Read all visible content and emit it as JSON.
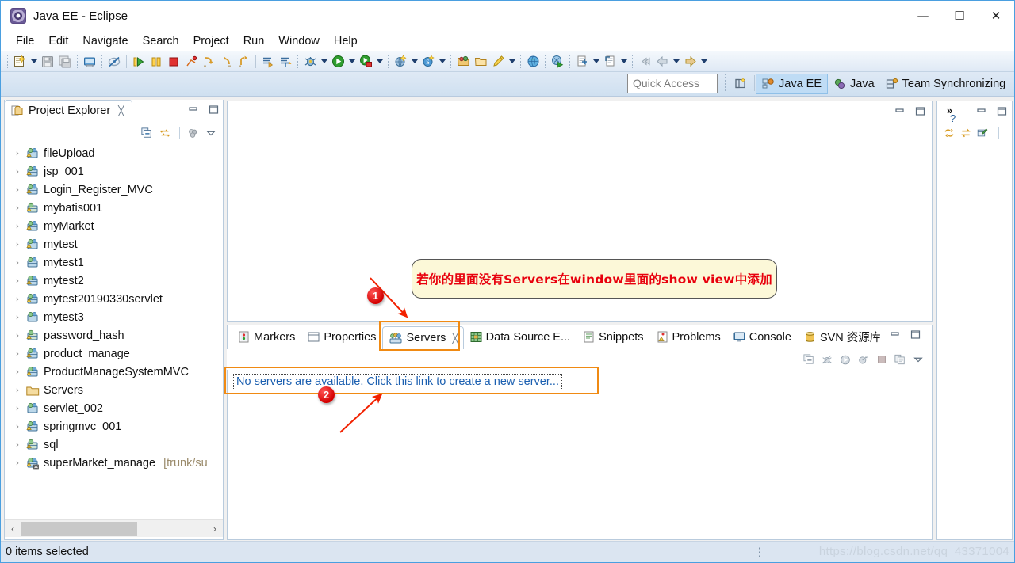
{
  "window": {
    "title": "Java EE - Eclipse",
    "app_icon": "eclipse-icon",
    "minimize": "—",
    "maximize": "☐",
    "close": "✕"
  },
  "menubar": {
    "items": [
      {
        "label": "File"
      },
      {
        "label": "Edit"
      },
      {
        "label": "Navigate"
      },
      {
        "label": "Search"
      },
      {
        "label": "Project"
      },
      {
        "label": "Run"
      },
      {
        "label": "Window"
      },
      {
        "label": "Help"
      }
    ]
  },
  "toolbar": {
    "groups": [
      {
        "icons": [
          "new-wizard-icon",
          "dropdown-caret"
        ]
      },
      {
        "icons": [
          "save-icon",
          "save-all-icon"
        ]
      },
      {
        "icons": [
          "print-icon"
        ]
      },
      {
        "icons": [
          "toggle-markoccurrences-icon"
        ]
      },
      {
        "icons": [
          "resume-icon",
          "suspend-icon",
          "terminate-icon",
          "disconnect-icon",
          "step-into-icon",
          "step-over-icon",
          "step-return-icon"
        ]
      },
      {
        "icons": [
          "next-annotation-icon",
          "previous-annotation-icon"
        ]
      },
      {
        "icons": [
          "debug-icon",
          "dropdown-caret",
          "run-icon",
          "dropdown-caret",
          "run-external-icon",
          "dropdown-caret"
        ]
      },
      {
        "icons": [
          "new-jee-artifact-icon",
          "dropdown-caret",
          "new-spring-icon",
          "dropdown-caret"
        ]
      },
      {
        "icons": [
          "open-type-icon",
          "open-folder-icon",
          "edit-icon",
          "dropdown-caret"
        ]
      },
      {
        "icons": [
          "web-browser-icon"
        ]
      },
      {
        "icons": [
          "run-server-icon"
        ]
      },
      {
        "icons": [
          "new-element-icon",
          "dropdown-caret",
          "new-note-icon",
          "dropdown-caret"
        ]
      },
      {
        "icons": [
          "back-history-icon",
          "back-icon",
          "dropdown-caret",
          "forward-icon",
          "dropdown-caret"
        ]
      }
    ]
  },
  "perspective_bar": {
    "quick_access_placeholder": "Quick Access",
    "open_perspective_icon": "open-perspective-icon",
    "perspectives": [
      {
        "label": "Java EE",
        "icon": "java-ee-perspective-icon",
        "active": true
      },
      {
        "label": "Java",
        "icon": "java-perspective-icon",
        "active": false
      },
      {
        "label": "Team Synchronizing",
        "icon": "team-sync-perspective-icon",
        "active": false
      }
    ]
  },
  "project_explorer": {
    "tab_label": "Project Explorer",
    "tab_icon": "project-explorer-icon",
    "close_glyph": "╳",
    "minimize_glyph": "━",
    "maximize_glyph": "□",
    "view_toolbar": [
      {
        "name": "collapse-all-icon"
      },
      {
        "name": "link-with-editor-icon"
      },
      {
        "name": "focus-on-active-task-icon"
      },
      {
        "name": "view-menu-icon"
      }
    ],
    "twisty_glyph": "›",
    "items": [
      {
        "label": "fileUpload",
        "icon": "dynamic-web-project-warning-icon",
        "suffix": ""
      },
      {
        "label": "jsp_001",
        "icon": "dynamic-web-project-warning-icon",
        "suffix": ""
      },
      {
        "label": "Login_Register_MVC",
        "icon": "dynamic-web-project-warning-icon",
        "suffix": ""
      },
      {
        "label": "mybatis001",
        "icon": "java-project-warning-icon",
        "suffix": ""
      },
      {
        "label": "myMarket",
        "icon": "dynamic-web-project-warning-icon",
        "suffix": ""
      },
      {
        "label": "mytest",
        "icon": "dynamic-web-project-warning-icon",
        "suffix": ""
      },
      {
        "label": "mytest1",
        "icon": "dynamic-web-project-icon",
        "suffix": ""
      },
      {
        "label": "mytest2",
        "icon": "dynamic-web-project-warning-icon",
        "suffix": ""
      },
      {
        "label": "mytest20190330servlet",
        "icon": "dynamic-web-project-warning-icon",
        "suffix": ""
      },
      {
        "label": "mytest3",
        "icon": "dynamic-web-project-icon",
        "suffix": ""
      },
      {
        "label": "password_hash",
        "icon": "java-project-warning-icon",
        "suffix": ""
      },
      {
        "label": "product_manage",
        "icon": "dynamic-web-project-warning-icon",
        "suffix": ""
      },
      {
        "label": "ProductManageSystemMVC",
        "icon": "dynamic-web-project-warning-icon",
        "suffix": ""
      },
      {
        "label": "Servers",
        "icon": "folder-icon",
        "suffix": ""
      },
      {
        "label": "servlet_002",
        "icon": "dynamic-web-project-icon",
        "suffix": ""
      },
      {
        "label": "springmvc_001",
        "icon": "dynamic-web-project-warning-icon",
        "suffix": ""
      },
      {
        "label": "sql",
        "icon": "java-project-warning-icon",
        "suffix": ""
      },
      {
        "label": "superMarket_manage",
        "icon": "dynamic-web-project-svn-icon",
        "suffix": "[trunk/su"
      }
    ],
    "hscroll_left": "‹",
    "hscroll_right": "›"
  },
  "editor_area": {
    "minimize_glyph": "━",
    "maximize_glyph": "□"
  },
  "right_panel": {
    "chevron": "»",
    "question": "?",
    "minimize_glyph": "━",
    "maximize_glyph": "□",
    "tools": [
      {
        "name": "synchronize-icon"
      },
      {
        "name": "refresh-arrows-icon"
      },
      {
        "name": "new-outgoing-icon"
      }
    ]
  },
  "bottom_panel": {
    "tabs": [
      {
        "label": "Markers",
        "icon": "markers-icon",
        "active": false,
        "closable": false
      },
      {
        "label": "Properties",
        "icon": "properties-icon",
        "active": false,
        "closable": false
      },
      {
        "label": "Servers",
        "icon": "servers-icon",
        "active": true,
        "closable": true
      },
      {
        "label": "Data Source E...",
        "icon": "data-source-explorer-icon",
        "active": false,
        "closable": false
      },
      {
        "label": "Snippets",
        "icon": "snippets-icon",
        "active": false,
        "closable": false
      },
      {
        "label": "Problems",
        "icon": "problems-icon",
        "active": false,
        "closable": false
      },
      {
        "label": "Console",
        "icon": "console-icon",
        "active": false,
        "closable": false
      },
      {
        "label": "SVN 资源库",
        "icon": "svn-repository-icon",
        "active": false,
        "closable": false
      }
    ],
    "close_glyph": "╳",
    "minimize_glyph": "━",
    "maximize_glyph": "□",
    "servers_toolbar": [
      {
        "name": "collapse-all-icon"
      },
      {
        "name": "debug-server-icon"
      },
      {
        "name": "start-server-icon"
      },
      {
        "name": "profile-server-icon"
      },
      {
        "name": "stop-server-icon"
      },
      {
        "name": "publish-server-icon"
      },
      {
        "name": "view-menu-icon"
      }
    ],
    "servers_link": "No servers are available. Click this link to create a new server..."
  },
  "statusbar": {
    "selection_text": "0 items selected",
    "watermark": "https://blog.csdn.net/qq_43371004"
  },
  "annotations": {
    "callout_text": "若你的里面没有Servers在window里面的show view中添加",
    "badge_1": "1",
    "badge_2": "2",
    "highlight_color": "#f08a13",
    "arrow_color": "#f22100",
    "callout_bg": "#fcf8d8",
    "callout_text_color": "#e8000d"
  }
}
